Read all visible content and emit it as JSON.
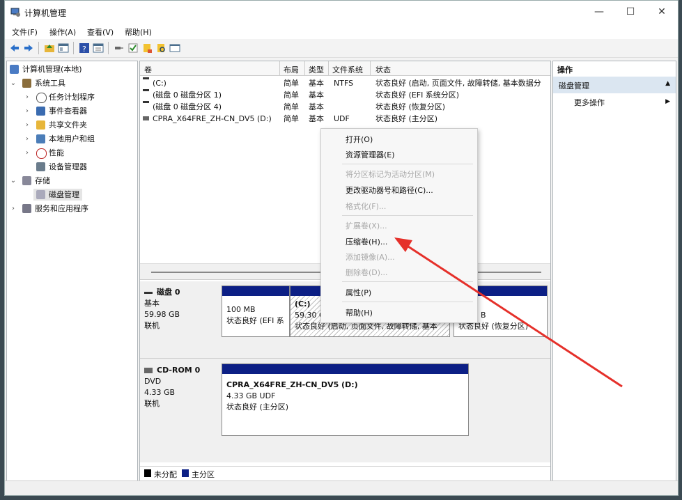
{
  "window": {
    "title": "计算机管理",
    "controls": [
      "—",
      "☐",
      "✕"
    ]
  },
  "menu": [
    "文件(F)",
    "操作(A)",
    "查看(V)",
    "帮助(H)"
  ],
  "tree": {
    "root": "计算机管理(本地)",
    "system_tools": "系统工具",
    "task_scheduler": "任务计划程序",
    "event_viewer": "事件查看器",
    "shared_folders": "共享文件夹",
    "local_users": "本地用户和组",
    "performance": "性能",
    "device_manager": "设备管理器",
    "storage": "存储",
    "disk_management": "磁盘管理",
    "services_apps": "服务和应用程序"
  },
  "volume_table": {
    "headers": [
      "卷",
      "布局",
      "类型",
      "文件系统",
      "状态"
    ],
    "rows": [
      {
        "volume": "(C:)",
        "layout": "简单",
        "type": "基本",
        "fs": "NTFS",
        "status": "状态良好 (启动, 页面文件, 故障转储, 基本数据分"
      },
      {
        "volume": "(磁盘 0 磁盘分区 1)",
        "layout": "简单",
        "type": "基本",
        "fs": "",
        "status": "状态良好 (EFI 系统分区)"
      },
      {
        "volume": "(磁盘 0 磁盘分区 4)",
        "layout": "简单",
        "type": "基本",
        "fs": "",
        "status": "状态良好 (恢复分区)"
      },
      {
        "volume": "CPRA_X64FRE_ZH-CN_DV5 (D:)",
        "layout": "简单",
        "type": "基本",
        "fs": "UDF",
        "status": "状态良好 (主分区)"
      }
    ]
  },
  "disk0": {
    "name": "磁盘 0",
    "type": "基本",
    "size": "59.98 GB",
    "state": "联机",
    "p1_size": "100 MB",
    "p1_status": "状态良好 (EFI 系",
    "p2_name": "(C:)",
    "p2_size": "59.30 G",
    "p2_status": "状态良好 (启动, 页面文件, 故障转储, 基本",
    "p3_size": "B",
    "p3_status": "状态良好 (恢复分区)"
  },
  "cdrom0": {
    "name": "CD-ROM 0",
    "type": "DVD",
    "size": "4.33 GB",
    "state": "联机",
    "vol_name": "CPRA_X64FRE_ZH-CN_DV5  (D:)",
    "vol_size": "4.33 GB UDF",
    "vol_status": "状态良好 (主分区)"
  },
  "legend": {
    "unallocated": "未分配",
    "primary": "主分区",
    "unallocated_color": "#000000",
    "primary_color": "#0c1f85"
  },
  "actions": {
    "header": "操作",
    "group": "磁盘管理",
    "more": "更多操作"
  },
  "context_menu": {
    "open": "打开(O)",
    "explorer": "资源管理器(E)",
    "mark_active": "将分区标记为活动分区(M)",
    "change_letter": "更改驱动器号和路径(C)...",
    "format": "格式化(F)...",
    "extend": "扩展卷(X)...",
    "shrink": "压缩卷(H)...",
    "add_mirror": "添加镜像(A)...",
    "delete": "删除卷(D)...",
    "properties": "属性(P)",
    "help": "帮助(H)"
  },
  "annotation_color": "#e5302a"
}
